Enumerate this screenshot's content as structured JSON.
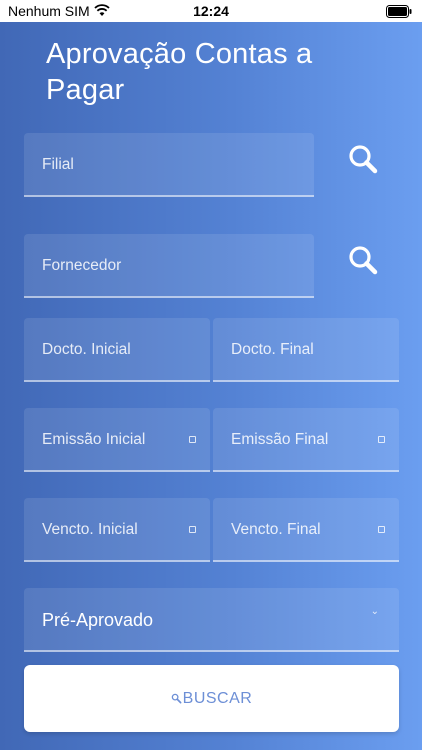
{
  "status": {
    "carrier": "Nenhum SIM",
    "time": "12:24"
  },
  "title": "Aprovação Contas a Pagar",
  "filial": {
    "label": "Filial"
  },
  "fornecedor": {
    "label": "Fornecedor"
  },
  "docto_inicial": {
    "label": "Docto. Inicial"
  },
  "docto_final": {
    "label": "Docto. Final"
  },
  "emissao_inicial": {
    "label": "Emissão Inicial"
  },
  "emissao_final": {
    "label": "Emissão Final"
  },
  "vencto_inicial": {
    "label": "Vencto. Inicial"
  },
  "vencto_final": {
    "label": "Vencto. Final"
  },
  "status_select": {
    "value": "Pré-Aprovado"
  },
  "buscar": {
    "label": "BUSCAR"
  },
  "colors": {
    "gradient_start": "#4168b6",
    "gradient_end": "#6b9ef0",
    "button_text": "#6d8fd6"
  },
  "icons": [
    "wifi-icon",
    "battery-icon",
    "search-icon",
    "calendar-icon",
    "chevron-down-icon"
  ]
}
